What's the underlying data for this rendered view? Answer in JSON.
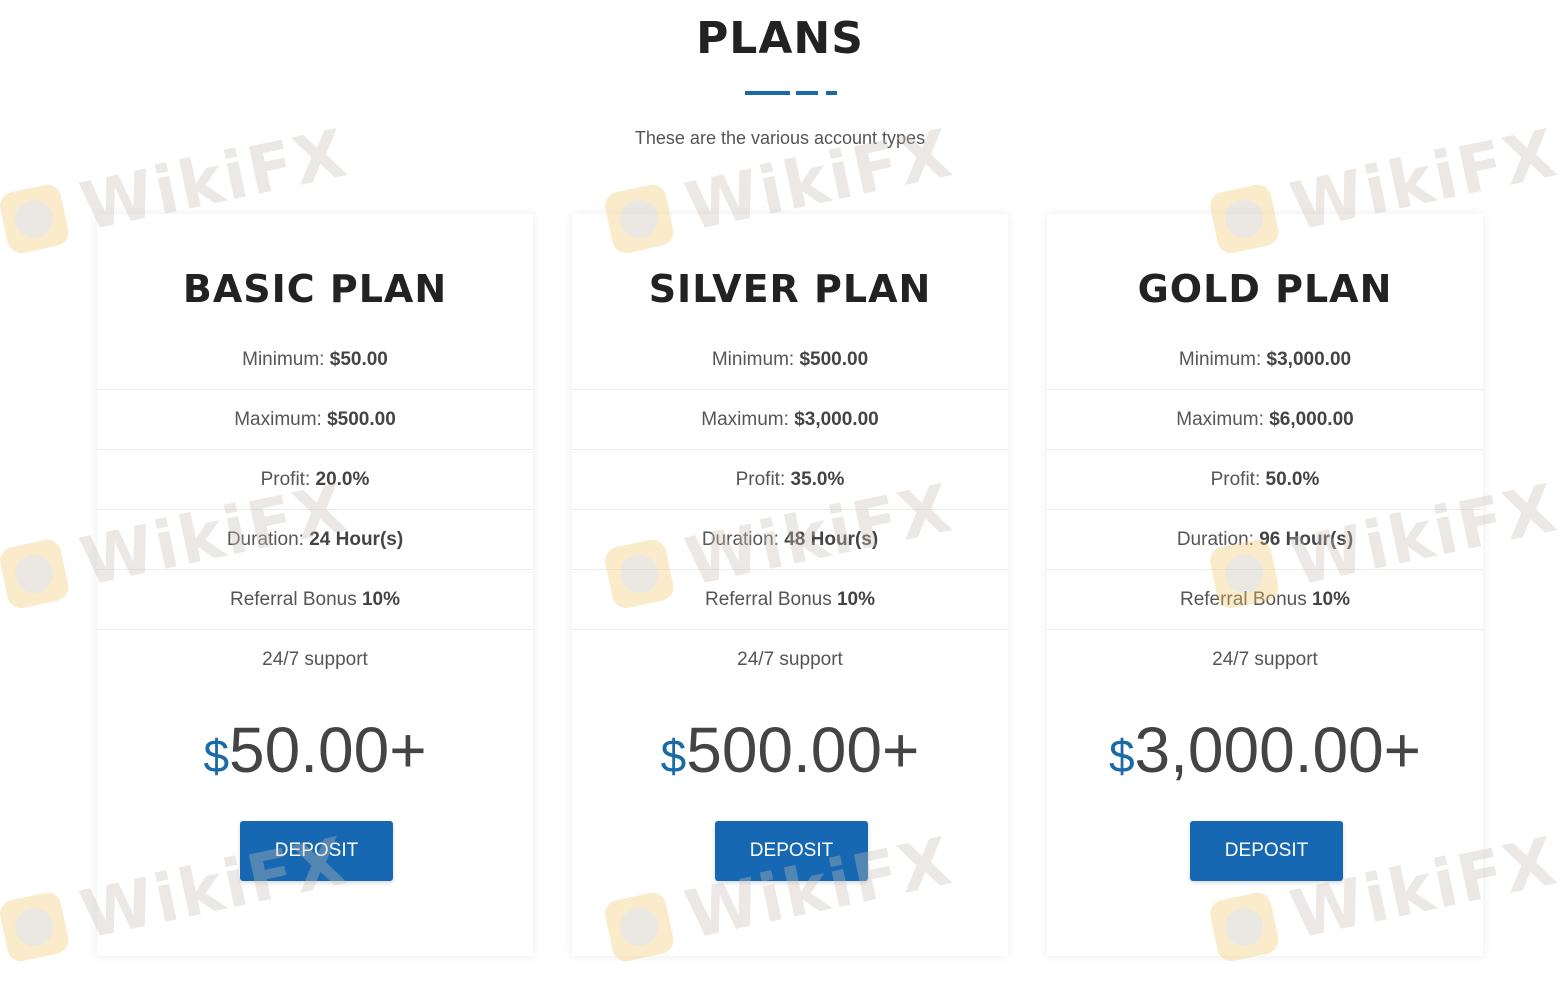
{
  "header": {
    "title": "PLANS",
    "subtitle": "These are the various account types",
    "accent_color": "#1a6aa8"
  },
  "plans": [
    {
      "name": "BASIC PLAN",
      "minimum_label": "Minimum: ",
      "minimum": "$50.00",
      "maximum_label": "Maximum: ",
      "maximum": "$500.00",
      "profit_label": "Profit: ",
      "profit": "20.0%",
      "duration_label": "Duration: ",
      "duration": "24 Hour(s)",
      "referral_label": "Referral Bonus ",
      "referral": "10%",
      "support": "24/7 support",
      "currency": "$",
      "price": "50.00+",
      "button_label": "DEPOSIT"
    },
    {
      "name": "SILVER PLAN",
      "minimum_label": "Minimum: ",
      "minimum": "$500.00",
      "maximum_label": "Maximum: ",
      "maximum": "$3,000.00",
      "profit_label": "Profit: ",
      "profit": "35.0%",
      "duration_label": "Duration: ",
      "duration": "48 Hour(s)",
      "referral_label": "Referral Bonus ",
      "referral": "10%",
      "support": "24/7 support",
      "currency": "$",
      "price": "500.00+",
      "button_label": "DEPOSIT"
    },
    {
      "name": "GOLD PLAN",
      "minimum_label": "Minimum: ",
      "minimum": "$3,000.00",
      "maximum_label": "Maximum: ",
      "maximum": "$6,000.00",
      "profit_label": "Profit: ",
      "profit": "50.0%",
      "duration_label": "Duration: ",
      "duration": "96 Hour(s)",
      "referral_label": "Referral Bonus ",
      "referral": "10%",
      "support": "24/7 support",
      "currency": "$",
      "price": "3,000.00+",
      "button_label": "DEPOSIT"
    }
  ],
  "watermark": {
    "text": "WikiFX",
    "icon": "wikifx-logo-icon"
  },
  "colors": {
    "button": "#1668b3",
    "currency": "#1a6aa8",
    "heading": "#222222"
  }
}
